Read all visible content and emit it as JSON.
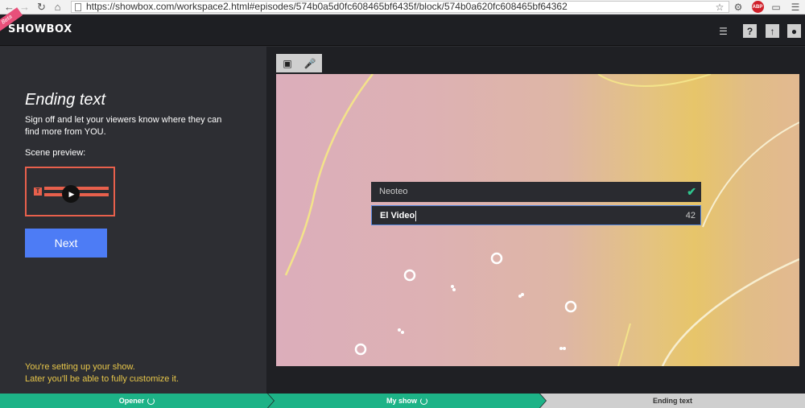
{
  "browser": {
    "url": "https://showbox.com/workspace2.html#episodes/574b0a5d0fc608465bf6435f/block/574b0a620fc608465bf64362",
    "back_icon": "back-arrow-icon",
    "forward_icon": "forward-arrow-icon",
    "reload_icon": "reload-icon",
    "home_icon": "home-icon",
    "abp_label": "ABP"
  },
  "header": {
    "logo": "SHOWBOX",
    "beta": "Beta",
    "help_label": "?"
  },
  "left": {
    "title": "Ending text",
    "description": "Sign off and let your viewers know where they can find more from YOU.",
    "preview_label": "Scene preview:",
    "preview_t": "T",
    "next_label": "Next",
    "note_line1": "You're setting up your show.",
    "note_line2": "Later you'll be able to fully customize it."
  },
  "canvas": {
    "name_value": "Neoteo",
    "title_value": "El Video",
    "char_count": "42",
    "colors": {
      "accent": "#4d7cf5",
      "check": "#2fc58e",
      "preview": "#e8604c"
    }
  },
  "steps": [
    {
      "label": "Opener",
      "status": "done"
    },
    {
      "label": "My show",
      "status": "done"
    },
    {
      "label": "Ending text",
      "status": "current"
    }
  ]
}
